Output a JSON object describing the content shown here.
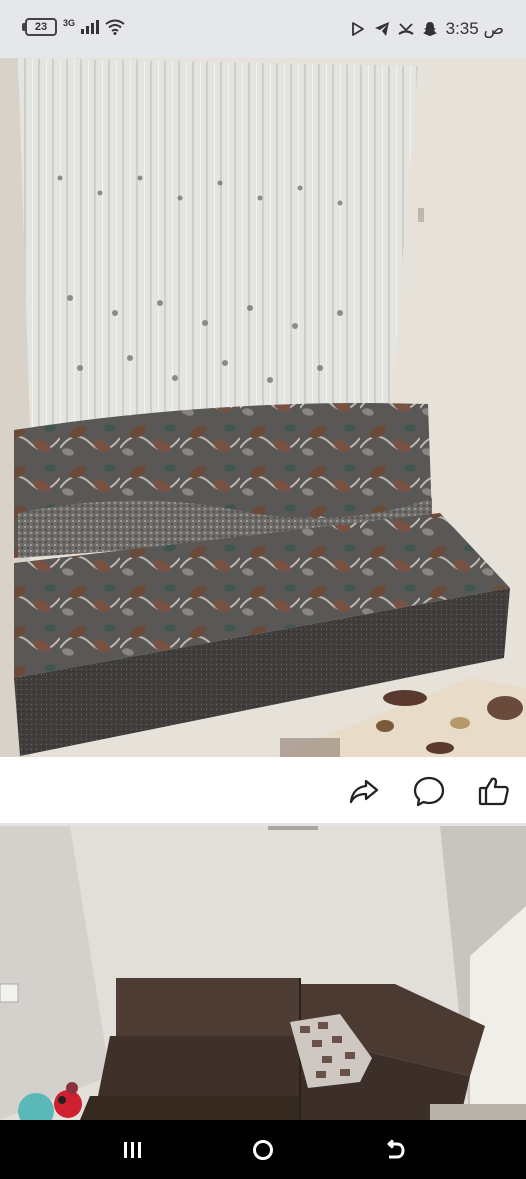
{
  "status_bar": {
    "battery_level": "23",
    "network_type": "3G",
    "time_text": "3:35 ص",
    "icons": [
      "play-store-icon",
      "telegram-icon",
      "missed-call-icon",
      "snapchat-icon"
    ]
  },
  "post": {
    "photos": [
      {
        "name": "patterned-sofa-photo",
        "description_icon": "photo"
      },
      {
        "name": "brown-corner-sofa-photo",
        "description_icon": "photo"
      }
    ],
    "actions": [
      "share-icon",
      "comment-icon",
      "like-icon"
    ]
  },
  "nav_bar": {
    "buttons": [
      "recents-icon",
      "home-icon",
      "back-icon"
    ]
  },
  "colors": {
    "sofa_fabric": "#4a4a4a",
    "leaf_pattern": "#6b4a3a",
    "wall": "#e8e4dd",
    "curtain": "#e3e3df",
    "brown_sofa": "#4a3a32",
    "nav_bg": "#000000"
  }
}
